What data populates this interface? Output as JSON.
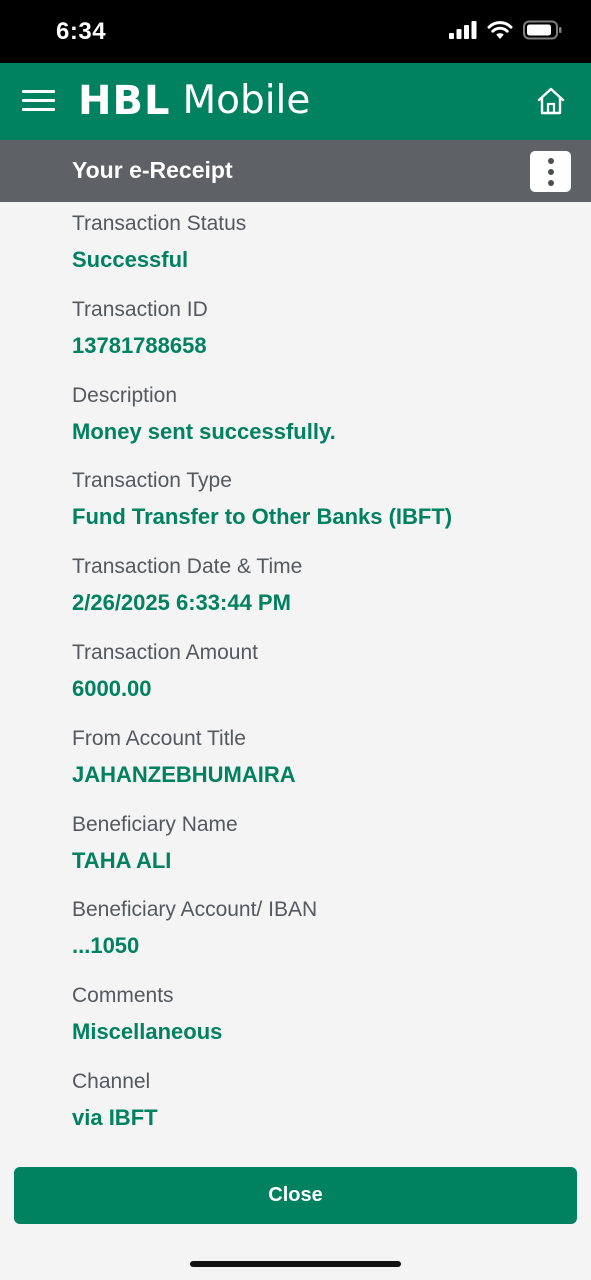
{
  "status_bar": {
    "time": "6:34"
  },
  "header": {
    "brand_primary": "HBL",
    "brand_secondary": "Mobile",
    "icons": [
      "menu-icon",
      "home-icon"
    ],
    "accent_color": "#00815f"
  },
  "subheader": {
    "title": "Your e-Receipt",
    "menu_icon": "more-vertical-icon"
  },
  "receipt": {
    "fields": [
      {
        "label": "Transaction Status",
        "value": "Successful"
      },
      {
        "label": "Transaction ID",
        "value": "13781788658"
      },
      {
        "label": "Description",
        "value": "Money sent successfully."
      },
      {
        "label": "Transaction Type",
        "value": "Fund Transfer to Other Banks (IBFT)"
      },
      {
        "label": "Transaction Date & Time",
        "value": "2/26/2025 6:33:44 PM"
      },
      {
        "label": "Transaction Amount",
        "value": "6000.00"
      },
      {
        "label": "From Account Title",
        "value": "JAHANZEBHUMAIRA"
      },
      {
        "label": "Beneficiary Name",
        "value": "TAHA ALI"
      },
      {
        "label": "Beneficiary Account/ IBAN",
        "value": "...1050"
      },
      {
        "label": "Comments",
        "value": "Miscellaneous"
      },
      {
        "label": "Channel",
        "value": "via IBFT"
      }
    ]
  },
  "footer": {
    "close_label": "Close"
  }
}
